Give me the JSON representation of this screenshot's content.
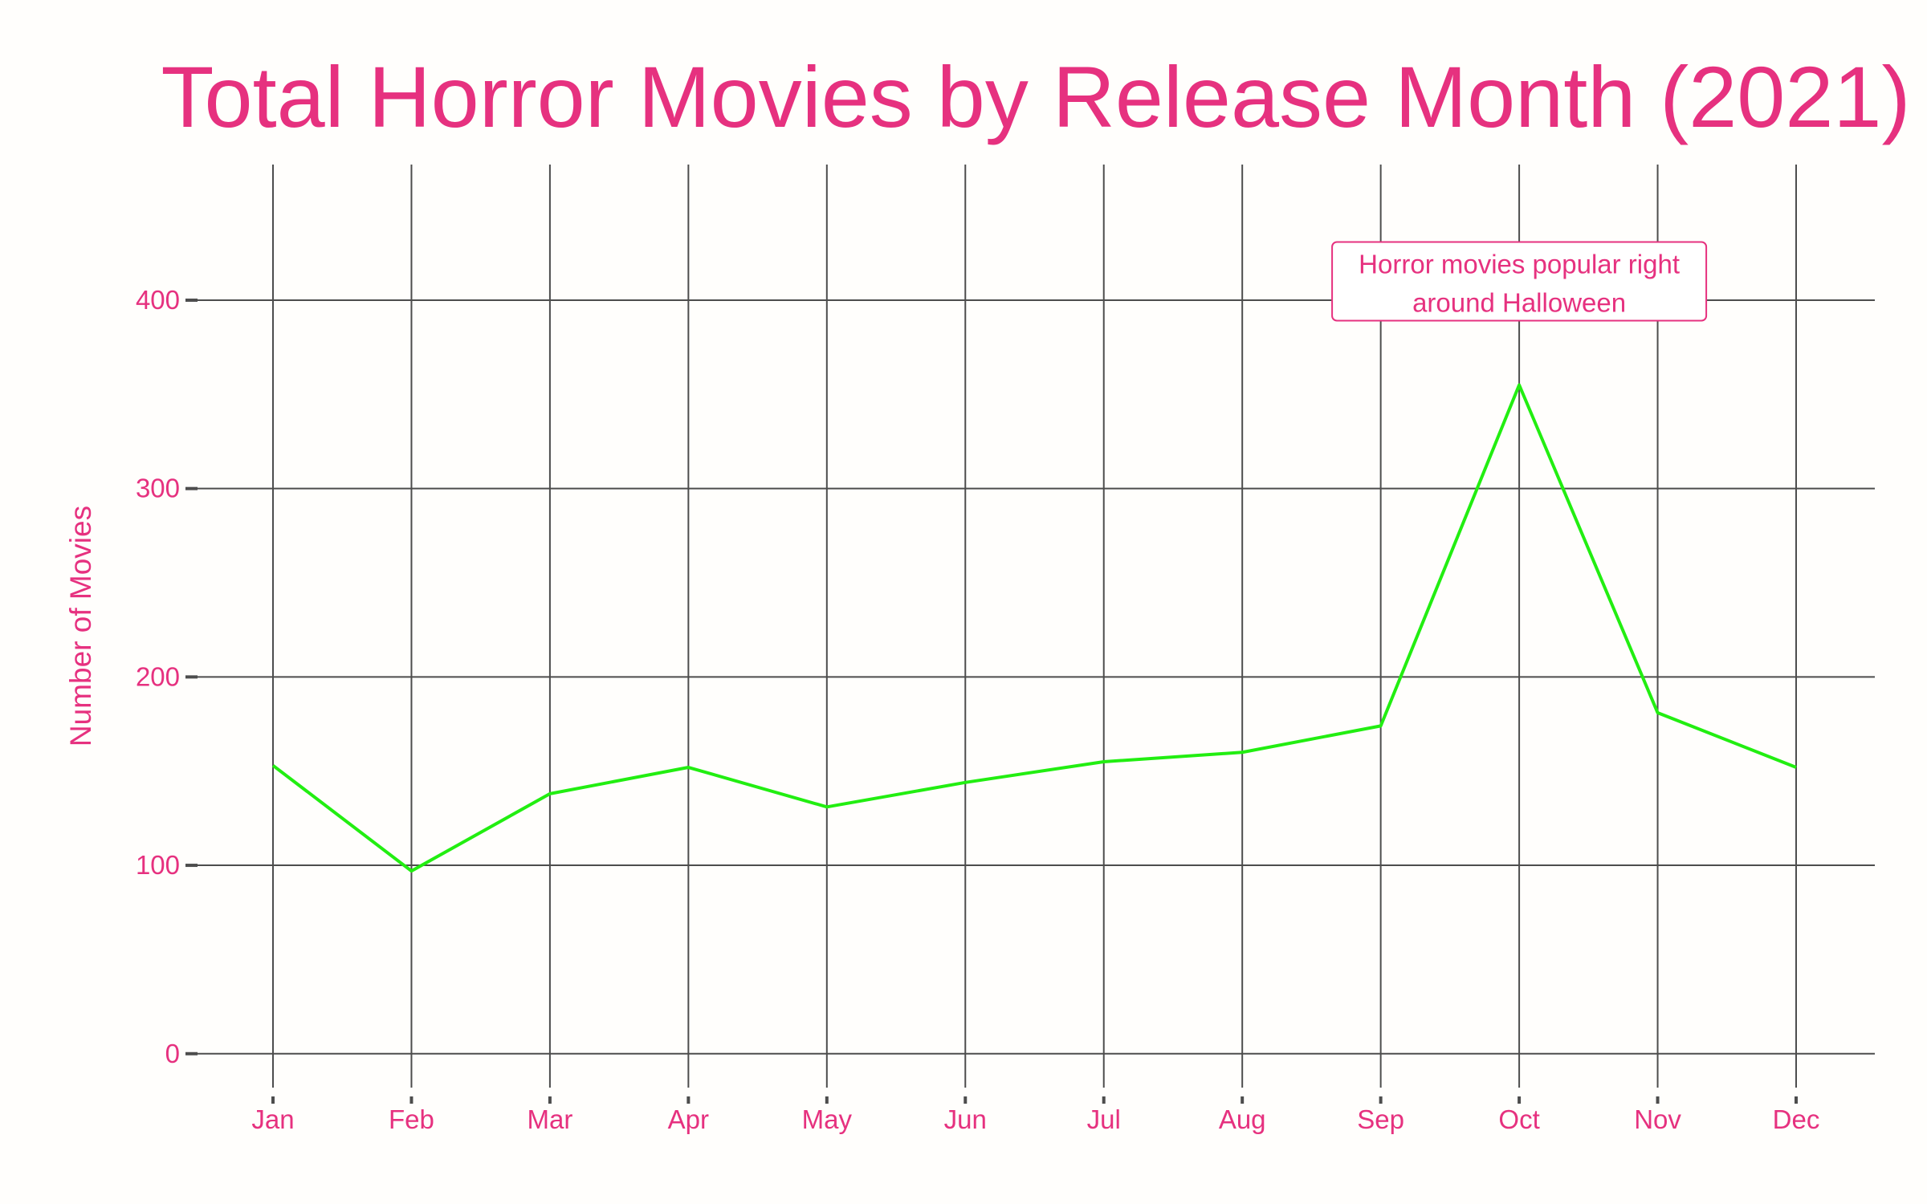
{
  "chart_data": {
    "type": "line",
    "title": "Total Horror Movies by Release Month (2021)",
    "xlabel": "",
    "ylabel": "Number of Movies",
    "categories": [
      "Jan",
      "Feb",
      "Mar",
      "Apr",
      "May",
      "Jun",
      "Jul",
      "Aug",
      "Sep",
      "Oct",
      "Nov",
      "Dec"
    ],
    "series": [
      {
        "values": [
          153,
          97,
          138,
          152,
          131,
          144,
          155,
          160,
          174,
          355,
          181,
          152
        ]
      }
    ],
    "ylim": [
      -18,
      472
    ],
    "yticks": [
      0,
      100,
      200,
      300,
      400
    ],
    "grid": true,
    "legend": "none",
    "annotation": {
      "lines": [
        "Horror movies popular right",
        "around Halloween"
      ],
      "category": "Oct",
      "value": 410
    },
    "colors": {
      "text": "#e6317f",
      "line": "#22ee11",
      "grid": "#4d4d4d",
      "background": "#fffefc"
    }
  }
}
